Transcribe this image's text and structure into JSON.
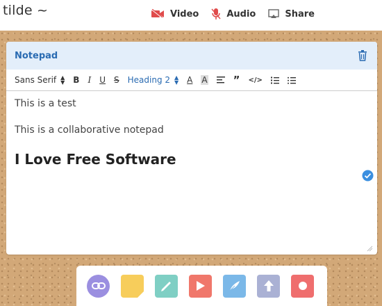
{
  "app": {
    "logo": "tilde ~"
  },
  "nav": {
    "video": "Video",
    "audio": "Audio",
    "share": "Share"
  },
  "card": {
    "title": "Notepad",
    "toolbar": {
      "font": "Sans Serif",
      "heading": "Heading 2"
    },
    "content": {
      "line1": "This is a test",
      "line2": "This is a collaborative notepad",
      "heading": "I Love Free Software"
    }
  },
  "colors": {
    "accent": "#2a6bb2",
    "nav_icons": "#e04b4b",
    "dock_link": "#9b8fe0",
    "dock_note": "#f7cd5b",
    "dock_pen": "#7fcfc4",
    "dock_video": "#f0776b",
    "dock_draw": "#7bb8e8",
    "dock_upload": "#aab1d4",
    "dock_record": "#ef6e6e"
  }
}
